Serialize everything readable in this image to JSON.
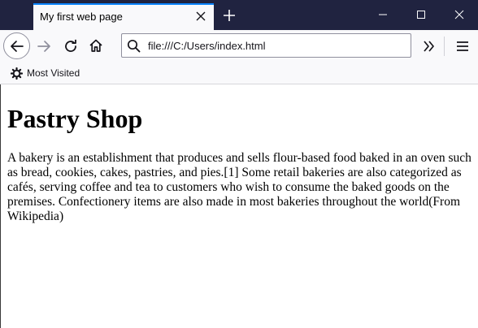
{
  "tab": {
    "title": "My first web page"
  },
  "window": {
    "controls": [
      "minimize-icon",
      "maximize-icon",
      "close-icon"
    ]
  },
  "navigation": {
    "url": "file:///C:/Users/index.html"
  },
  "bookmarks": {
    "items": [
      {
        "label": "Most Visited",
        "icon": "gear-icon"
      }
    ]
  },
  "page": {
    "heading": "Pastry Shop",
    "paragraph": "A bakery is an establishment that produces and sells flour-based food baked in an oven such as bread, cookies, cakes, pastries, and pies.[1] Some retail bakeries are also categorized as cafés, serving coffee and tea to customers who wish to consume the baked goods on the premises. Confectionery items are also made in most bakeries throughout the world(From Wikipedia)"
  },
  "colors": {
    "titlebar": "#202340",
    "toolbar": "#f9f9fb",
    "tab_accent": "#0a84ff"
  }
}
